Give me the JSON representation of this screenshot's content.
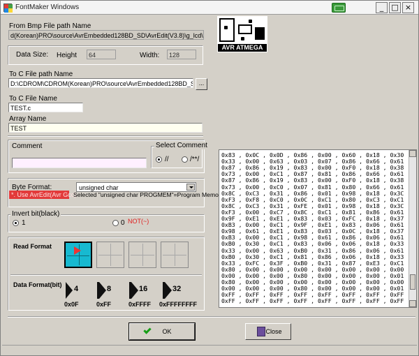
{
  "window": {
    "title": "FontMaker Windows",
    "controls": {
      "minimize": "_",
      "maximize": "□",
      "close": "×"
    }
  },
  "bmp": {
    "label": "From Bmp File path  Name",
    "path": "d(Korean)PRO\\source\\AvrEmbedded128BD_SD\\AvrEdit(V3.8)\\g_lcd\\TEST.BMP"
  },
  "datasize": {
    "label": "Data Size:",
    "height_label": "Height",
    "height_value": "64",
    "width_label": "Width:",
    "width_value": "128"
  },
  "cfile_path": {
    "label": "To C File path Name",
    "path": "D:\\CDROM\\CDROM(Korean)PRO\\source\\AvrEmbedded128BD_SD\\AvrEdit",
    "browse": "..."
  },
  "cfile_name": {
    "label": "To C File Name",
    "value": "TEST.c"
  },
  "array_name": {
    "label": "Array Name",
    "value": "TEST"
  },
  "comment": {
    "label": "Comment",
    "value": "",
    "select_label": "Select Comment",
    "opt1": "//",
    "opt2": "/**/"
  },
  "byte_format": {
    "label": "Byte Format:",
    "selected": "unsigned char",
    "note_red": "*. Use AvrEdit(Avr Gcc)",
    "note": "Selected \"unsigned char PROGMEM\"=Program Memory"
  },
  "invert": {
    "label": "Invert bit(black)",
    "opt1": "1",
    "opt0": "0",
    "not_label": "NOT(~)"
  },
  "read_format": {
    "label": "Read Format"
  },
  "data_format": {
    "label": "Data Format(bit)",
    "items": [
      {
        "num": "4",
        "hex": "0x0F"
      },
      {
        "num": "8",
        "hex": "0xFF"
      },
      {
        "num": "16",
        "hex": "0xFFFF"
      },
      {
        "num": "32",
        "hex": "0xFFFFFFFF"
      }
    ]
  },
  "logo": {
    "text": "AVR ATMEGA"
  },
  "hex_lines": [
    "0x83 , 0x0C , 0x0D , 0x86 , 0x00 , 0x60 , 0x18 , 0x30",
    "0x33 , 0x00 , 0x63 , 0x03 , 0x07 , 0x86 , 0x66 , 0x61",
    "0x87 , 0x86 , 0x19 , 0x83 , 0x00 , 0xF0 , 0x18 , 0x38",
    "0x73 , 0x00 , 0xC1 , 0x87 , 0x81 , 0x86 , 0x66 , 0x61",
    "0x87 , 0x86 , 0x19 , 0x83 , 0x00 , 0xF0 , 0x18 , 0x38",
    "0x73 , 0x00 , 0xC0 , 0x07 , 0x81 , 0x80 , 0x66 , 0x61",
    "0x8C , 0xC3 , 0x31 , 0x86 , 0x01 , 0x98 , 0x18 , 0x3C",
    "0xF3 , 0xF8 , 0xC0 , 0x0C , 0xC1 , 0x80 , 0xC3 , 0xC1",
    "0x8C , 0xC3 , 0x31 , 0xFE , 0x01 , 0x98 , 0x18 , 0x3C",
    "0xF3 , 0x00 , 0xC7 , 0x8C , 0xC1 , 0x81 , 0x86 , 0x61",
    "0x9F , 0xE1 , 0xE1 , 0x83 , 0x03 , 0xFC , 0x18 , 0x37",
    "0xB3 , 0x00 , 0xC1 , 0x9F , 0xE1 , 0x83 , 0x06 , 0x61",
    "0x98 , 0x61 , 0xE1 , 0x83 , 0x03 , 0x0C , 0x18 , 0x37",
    "0xB3 , 0x00 , 0xC1 , 0x98 , 0x61 , 0x86 , 0x06 , 0x61",
    "0xB0 , 0x30 , 0xC1 , 0x83 , 0x06 , 0x06 , 0x18 , 0x33",
    "0x33 , 0x00 , 0x63 , 0xB0 , 0x31 , 0x86 , 0x06 , 0x61",
    "0xB0 , 0x30 , 0xC1 , 0x81 , 0x86 , 0x06 , 0x18 , 0x33",
    "0x33 , 0xFC , 0x3F , 0xB0 , 0x31 , 0x87 , 0xE3 , 0xC1",
    "0x80 , 0x00 , 0x00 , 0x00 , 0x00 , 0x00 , 0x00 , 0x00",
    "0x00 , 0x00 , 0x00 , 0x80 , 0x00 , 0x00 , 0x00 , 0x01",
    "0x80 , 0x00 , 0x00 , 0x00 , 0x00 , 0x00 , 0x00 , 0x00",
    "0x00 , 0x00 , 0x00 , 0x80 , 0x00 , 0x00 , 0x00 , 0x01",
    "0xFF , 0xFF , 0xFF , 0xFF , 0xFF , 0xFF , 0xFF , 0xFF",
    "0xFF , 0xFF , 0xFF , 0xFF , 0xFF , 0xFF , 0xFF , 0xFF"
  ],
  "buttons": {
    "ok": "OK",
    "close": "Close"
  },
  "colors": {
    "accent_selected": "#17b9d0",
    "note_red": "#e02020"
  }
}
